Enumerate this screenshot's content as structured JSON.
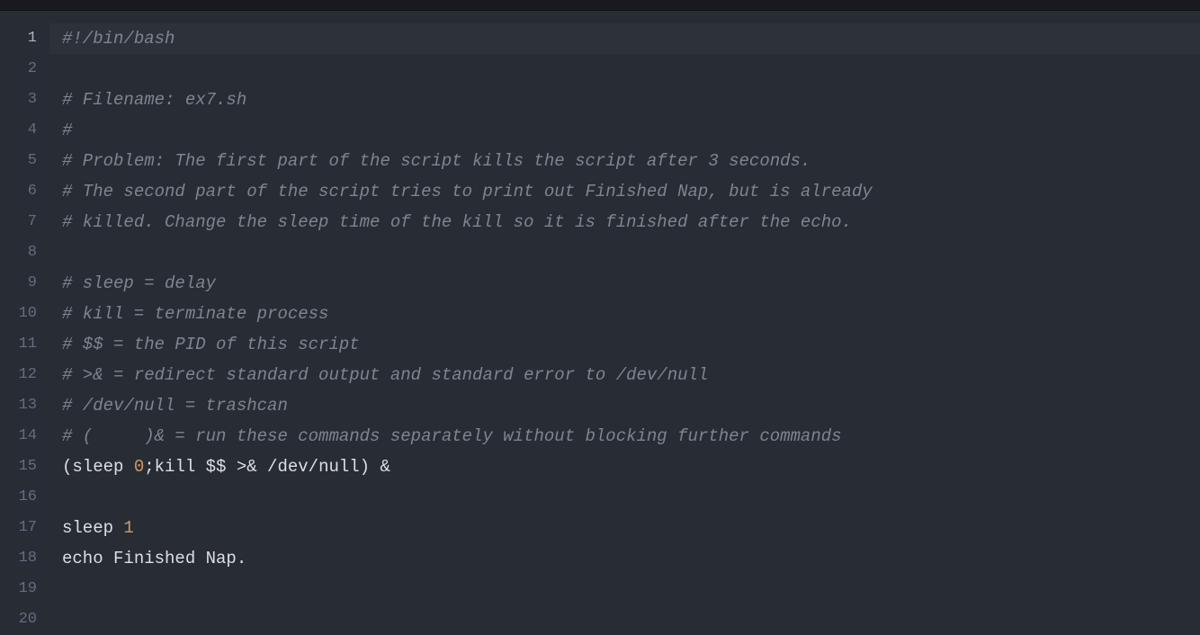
{
  "editor": {
    "active_line": 1,
    "lines": [
      {
        "n": 1,
        "tokens": [
          {
            "cls": "comment",
            "t": "#!/bin/bash"
          }
        ]
      },
      {
        "n": 2,
        "tokens": []
      },
      {
        "n": 3,
        "tokens": [
          {
            "cls": "comment",
            "t": "# Filename: ex7.sh"
          }
        ]
      },
      {
        "n": 4,
        "tokens": [
          {
            "cls": "comment",
            "t": "#"
          }
        ]
      },
      {
        "n": 5,
        "tokens": [
          {
            "cls": "comment",
            "t": "# Problem: The first part of the script kills the script after 3 seconds."
          }
        ]
      },
      {
        "n": 6,
        "tokens": [
          {
            "cls": "comment",
            "t": "# The second part of the script tries to print out Finished Nap, but is already"
          }
        ]
      },
      {
        "n": 7,
        "tokens": [
          {
            "cls": "comment",
            "t": "# killed. Change the sleep time of the kill so it is finished after the echo."
          }
        ]
      },
      {
        "n": 8,
        "tokens": []
      },
      {
        "n": 9,
        "tokens": [
          {
            "cls": "comment",
            "t": "# sleep = delay"
          }
        ]
      },
      {
        "n": 10,
        "tokens": [
          {
            "cls": "comment",
            "t": "# kill = terminate process"
          }
        ]
      },
      {
        "n": 11,
        "tokens": [
          {
            "cls": "comment",
            "t": "# $$ = the PID of this script"
          }
        ]
      },
      {
        "n": 12,
        "tokens": [
          {
            "cls": "comment",
            "t": "# >& = redirect standard output and standard error to /dev/null"
          }
        ]
      },
      {
        "n": 13,
        "tokens": [
          {
            "cls": "comment",
            "t": "# /dev/null = trashcan"
          }
        ]
      },
      {
        "n": 14,
        "tokens": [
          {
            "cls": "comment",
            "t": "# (     )& = run these commands separately without blocking further commands"
          }
        ]
      },
      {
        "n": 15,
        "tokens": [
          {
            "cls": "plain",
            "t": "(sleep "
          },
          {
            "cls": "number",
            "t": "0"
          },
          {
            "cls": "plain",
            "t": ";"
          },
          {
            "cls": "plain",
            "t": "kill $$ >& /dev/null) &"
          }
        ]
      },
      {
        "n": 16,
        "tokens": []
      },
      {
        "n": 17,
        "tokens": [
          {
            "cls": "plain",
            "t": "sleep "
          },
          {
            "cls": "number",
            "t": "1"
          }
        ]
      },
      {
        "n": 18,
        "tokens": [
          {
            "cls": "plain",
            "t": "echo"
          },
          {
            "cls": "plain",
            "t": " Finished Nap."
          }
        ]
      },
      {
        "n": 19,
        "tokens": []
      },
      {
        "n": 20,
        "tokens": []
      }
    ]
  }
}
